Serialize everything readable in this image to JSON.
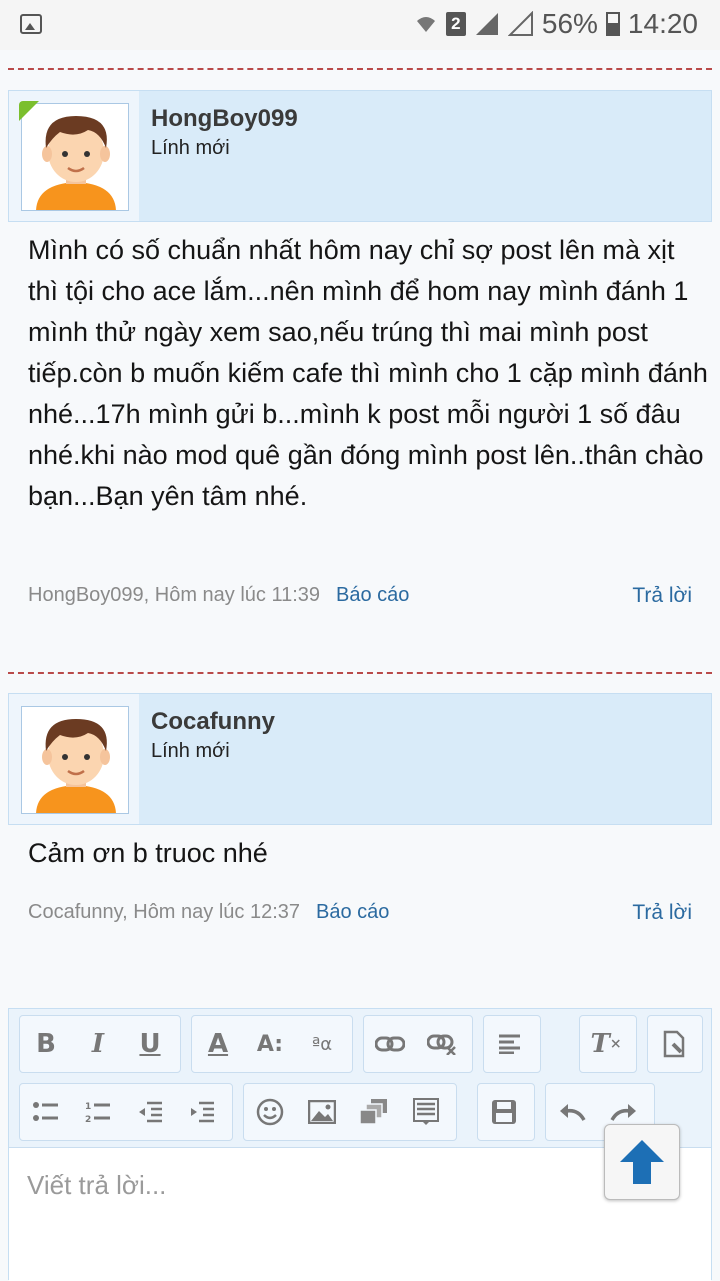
{
  "status_bar": {
    "signal_badge": "2",
    "battery": "56%",
    "time": "14:20"
  },
  "posts": [
    {
      "username": "HongBoy099",
      "rank": "Lính mới",
      "body": "Mình có số chuẩn nhất hôm nay chỉ sợ post lên mà xịt thì tội cho ace lắm...nên mình để hom nay mình đánh 1 mình thử ngày xem sao,nếu trúng thì mai mình post tiếp.còn b muốn kiếm cafe thì mình cho 1 cặp mình đánh nhé...17h mình gửi b...mình k post mỗi người 1 số đâu nhé.khi nào mod quê gần đóng mình post lên..thân chào bạn...Bạn yên tâm nhé.",
      "meta": "HongBoy099, Hôm nay lúc 11:39",
      "report": "Báo cáo",
      "reply": "Trả lời"
    },
    {
      "username": "Cocafunny",
      "rank": "Lính mới",
      "body": "Cảm ơn b truoc nhé",
      "meta": "Cocafunny, Hôm nay lúc 12:37",
      "report": "Báo cáo",
      "reply": "Trả lời"
    }
  ],
  "editor": {
    "placeholder": "Viết trả lời...",
    "toolbar_row1": [
      "bold-icon",
      "italic-icon",
      "underline-icon",
      "text-color-icon",
      "font-size-icon",
      "font-family-icon",
      "link-icon",
      "unlink-icon",
      "align-icon",
      "remove-format-icon",
      "toggle-bbcode-icon"
    ],
    "toolbar_row2": [
      "bullet-list-icon",
      "numbered-list-icon",
      "outdent-icon",
      "indent-icon",
      "smilie-icon",
      "image-icon",
      "media-icon",
      "quote-icon",
      "save-draft-icon",
      "undo-icon",
      "redo-icon"
    ]
  },
  "colors": {
    "accent": "#2b6aa0",
    "header_bg": "#d9ebf9",
    "separator": "#b94a4a",
    "new_member_flag": "#7bbf2e"
  }
}
